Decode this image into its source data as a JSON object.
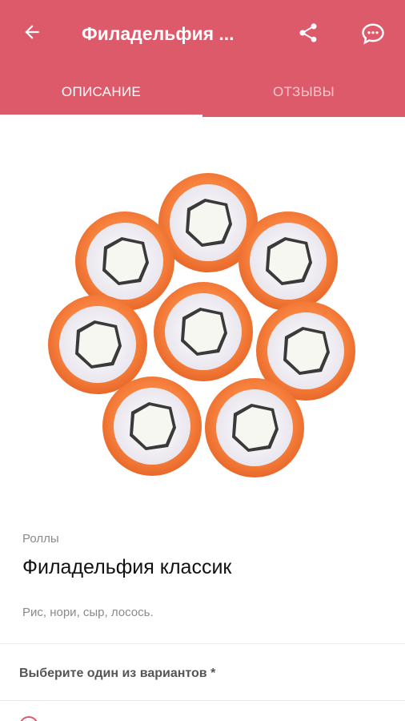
{
  "header": {
    "title": "Филадельфия ...",
    "back_icon": "arrow-left-icon",
    "share_icon": "share-icon",
    "chat_icon": "chat-icon",
    "background_color": "#dd5a6b"
  },
  "tabs": [
    {
      "label": "ОПИСАНИЕ",
      "active": true
    },
    {
      "label": "ОТЗЫВЫ",
      "active": false
    }
  ],
  "product": {
    "image": "sushi-rolls-image",
    "category": "Роллы",
    "name": "Филадельфия классик",
    "ingredients": "Рис, нори, сыр, лосось."
  },
  "variants": {
    "label": "Выберите один из вариантов *"
  }
}
